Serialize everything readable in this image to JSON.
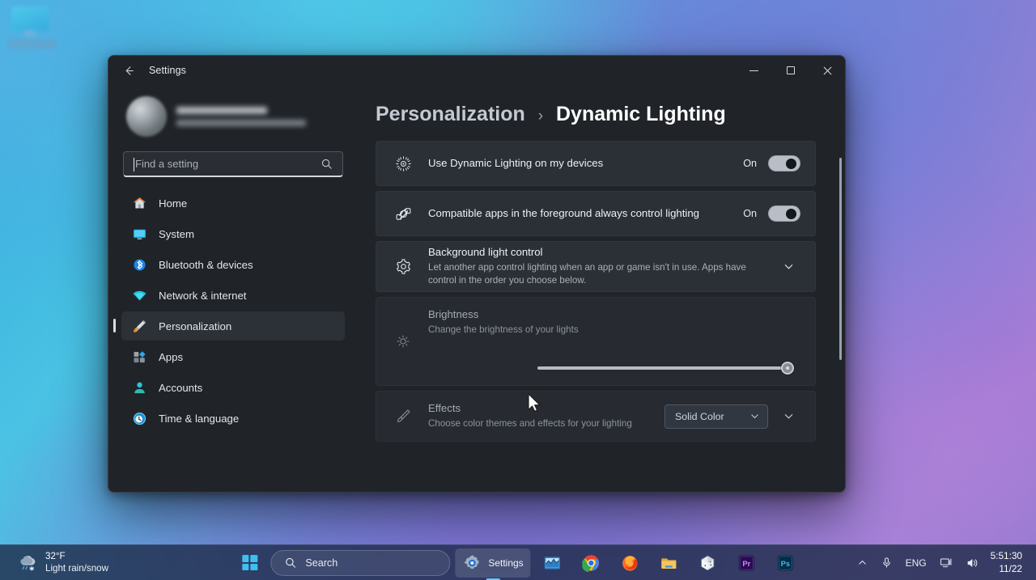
{
  "window": {
    "app_title": "Settings",
    "back_icon": "back-arrow-icon",
    "minimize_icon": "minimize-icon",
    "maximize_icon": "maximize-icon",
    "close_icon": "close-icon"
  },
  "sidebar": {
    "account": {
      "name_redacted": "",
      "email_redacted": ""
    },
    "search": {
      "placeholder": "Find a setting",
      "value": "",
      "icon": "search-icon"
    },
    "items": [
      {
        "label": "Home",
        "icon": "home-icon",
        "active": false
      },
      {
        "label": "System",
        "icon": "system-icon",
        "active": false
      },
      {
        "label": "Bluetooth & devices",
        "icon": "bluetooth-icon",
        "active": false
      },
      {
        "label": "Network & internet",
        "icon": "wifi-icon",
        "active": false
      },
      {
        "label": "Personalization",
        "icon": "paintbrush-icon",
        "active": true
      },
      {
        "label": "Apps",
        "icon": "apps-icon",
        "active": false
      },
      {
        "label": "Accounts",
        "icon": "account-icon",
        "active": false
      },
      {
        "label": "Time & language",
        "icon": "clock-icon",
        "active": false
      }
    ]
  },
  "content": {
    "breadcrumb": {
      "parent": "Personalization",
      "separator": "›",
      "current": "Dynamic Lighting"
    },
    "cards": [
      {
        "title": "Use Dynamic Lighting on my devices",
        "subtitle": "",
        "icon": "dynamic-lighting-icon",
        "toggle_label": "On",
        "toggle_state": true
      },
      {
        "title": "Compatible apps in the foreground always control lighting",
        "subtitle": "",
        "icon": "app-lighting-icon",
        "toggle_label": "On",
        "toggle_state": true
      },
      {
        "title": "Background light control",
        "subtitle": "Let another app control lighting when an app or game isn't in use. Apps have control in the order you choose below.",
        "icon": "gear-icon",
        "expand_icon": "chevron-down-icon"
      },
      {
        "title": "Brightness",
        "subtitle": "Change the brightness of your lights",
        "icon": "brightness-icon",
        "slider_value": 100,
        "slider_min": 0,
        "slider_max": 100,
        "disabled": true
      },
      {
        "title": "Effects",
        "subtitle": "Choose color themes and effects for your lighting",
        "icon": "effects-brush-icon",
        "dropdown_value": "Solid Color",
        "dropdown_icon": "chevron-down-icon",
        "expand_icon": "chevron-down-icon",
        "disabled": true
      }
    ]
  },
  "taskbar": {
    "weather": {
      "temperature": "32°F",
      "description": "Light rain/snow",
      "icon": "rain-snow-icon"
    },
    "start": {
      "label": "Start",
      "icon": "windows-logo-icon"
    },
    "search": {
      "label": "Search",
      "icon": "search-icon"
    },
    "apps": [
      {
        "label": "Settings",
        "icon": "settings-gear-icon",
        "active": true,
        "show_label": true
      },
      {
        "label": "Charts",
        "icon": "chart-app-icon",
        "active": false,
        "show_label": false
      },
      {
        "label": "Google Chrome",
        "icon": "chrome-icon",
        "active": false,
        "show_label": false
      },
      {
        "label": "Firefox",
        "icon": "firefox-icon",
        "active": false,
        "show_label": false
      },
      {
        "label": "File Explorer",
        "icon": "folder-icon",
        "active": false,
        "show_label": false
      },
      {
        "label": "VirtualBox",
        "icon": "virtualbox-icon",
        "active": false,
        "show_label": false
      },
      {
        "label": "Adobe Premiere Pro",
        "icon": "premiere-pro-icon",
        "active": false,
        "show_label": false
      },
      {
        "label": "Adobe Photoshop",
        "icon": "photoshop-icon",
        "active": false,
        "show_label": false
      }
    ],
    "tray": {
      "overflow_icon": "chevron-up-icon",
      "mic_icon": "microphone-icon",
      "language": "ENG",
      "network_icon": "network-icon",
      "volume_icon": "speaker-icon",
      "time": "5:51:30",
      "date": "11/22"
    }
  },
  "colors": {
    "window_bg": "#202429",
    "card_bg": "#2b2f36",
    "card_bg_dim": "#272b31",
    "accent": "#6fc4f2",
    "toggle_on_track": "#b9bec6"
  }
}
